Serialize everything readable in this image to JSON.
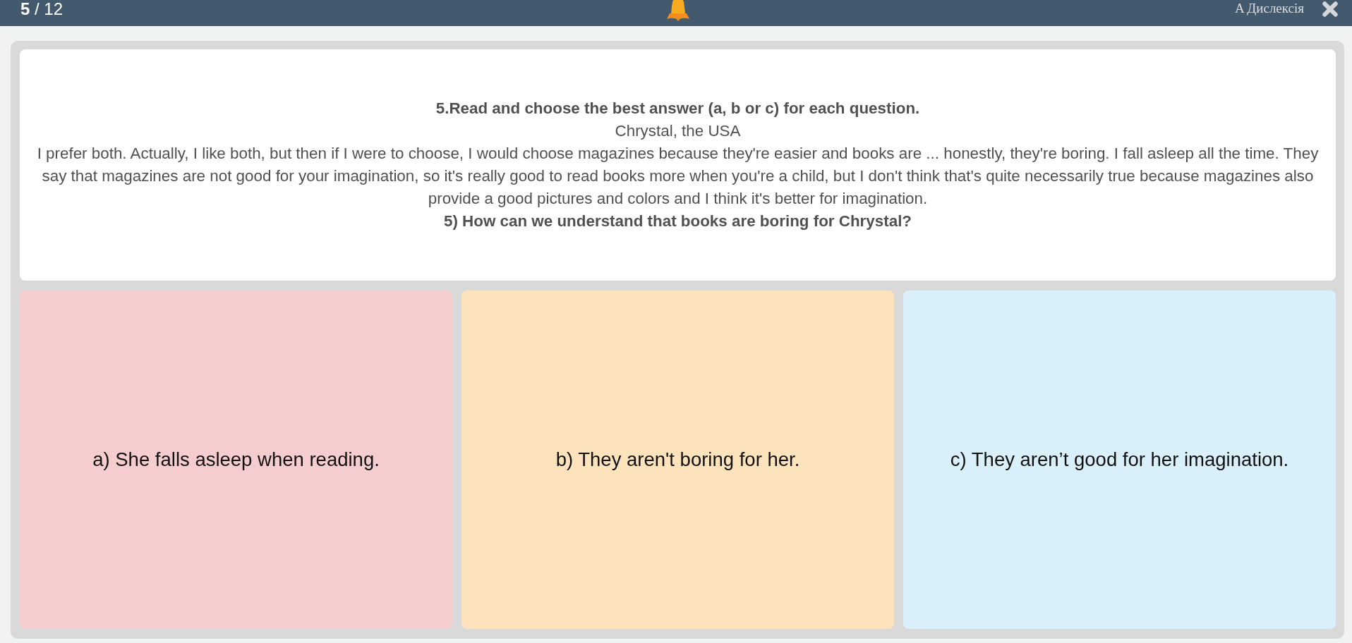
{
  "header": {
    "progress": {
      "current": "5",
      "total": "/ 12"
    },
    "dyslexia_button": "A Дислексія"
  },
  "question": {
    "instruction": "5.Read and choose the best answer (a, b or c) for each question.",
    "speaker": "Chrystal, the USA",
    "passage": "I prefer both. Actually, I like both, but then if I were to choose, I would choose magazines because they're easier and books are ... honestly, they're boring. I fall asleep all the time. They say that magazines are not good for your imagination, so it's really good to read books more when you're a child, but I don't think that's quite necessarily true because magazines also provide a good pictures and colors and I think it's better for imagination.",
    "prompt": "5) How can we understand that books are boring for Chrystal?"
  },
  "answers": [
    {
      "label": "a) She falls asleep when reading.",
      "color": "#f6cdcf"
    },
    {
      "label": "b) They aren't boring for her.",
      "color": "#fce3bb"
    },
    {
      "label": "c) They aren’t good for her imagination.",
      "color": "#d9f0fa"
    }
  ]
}
